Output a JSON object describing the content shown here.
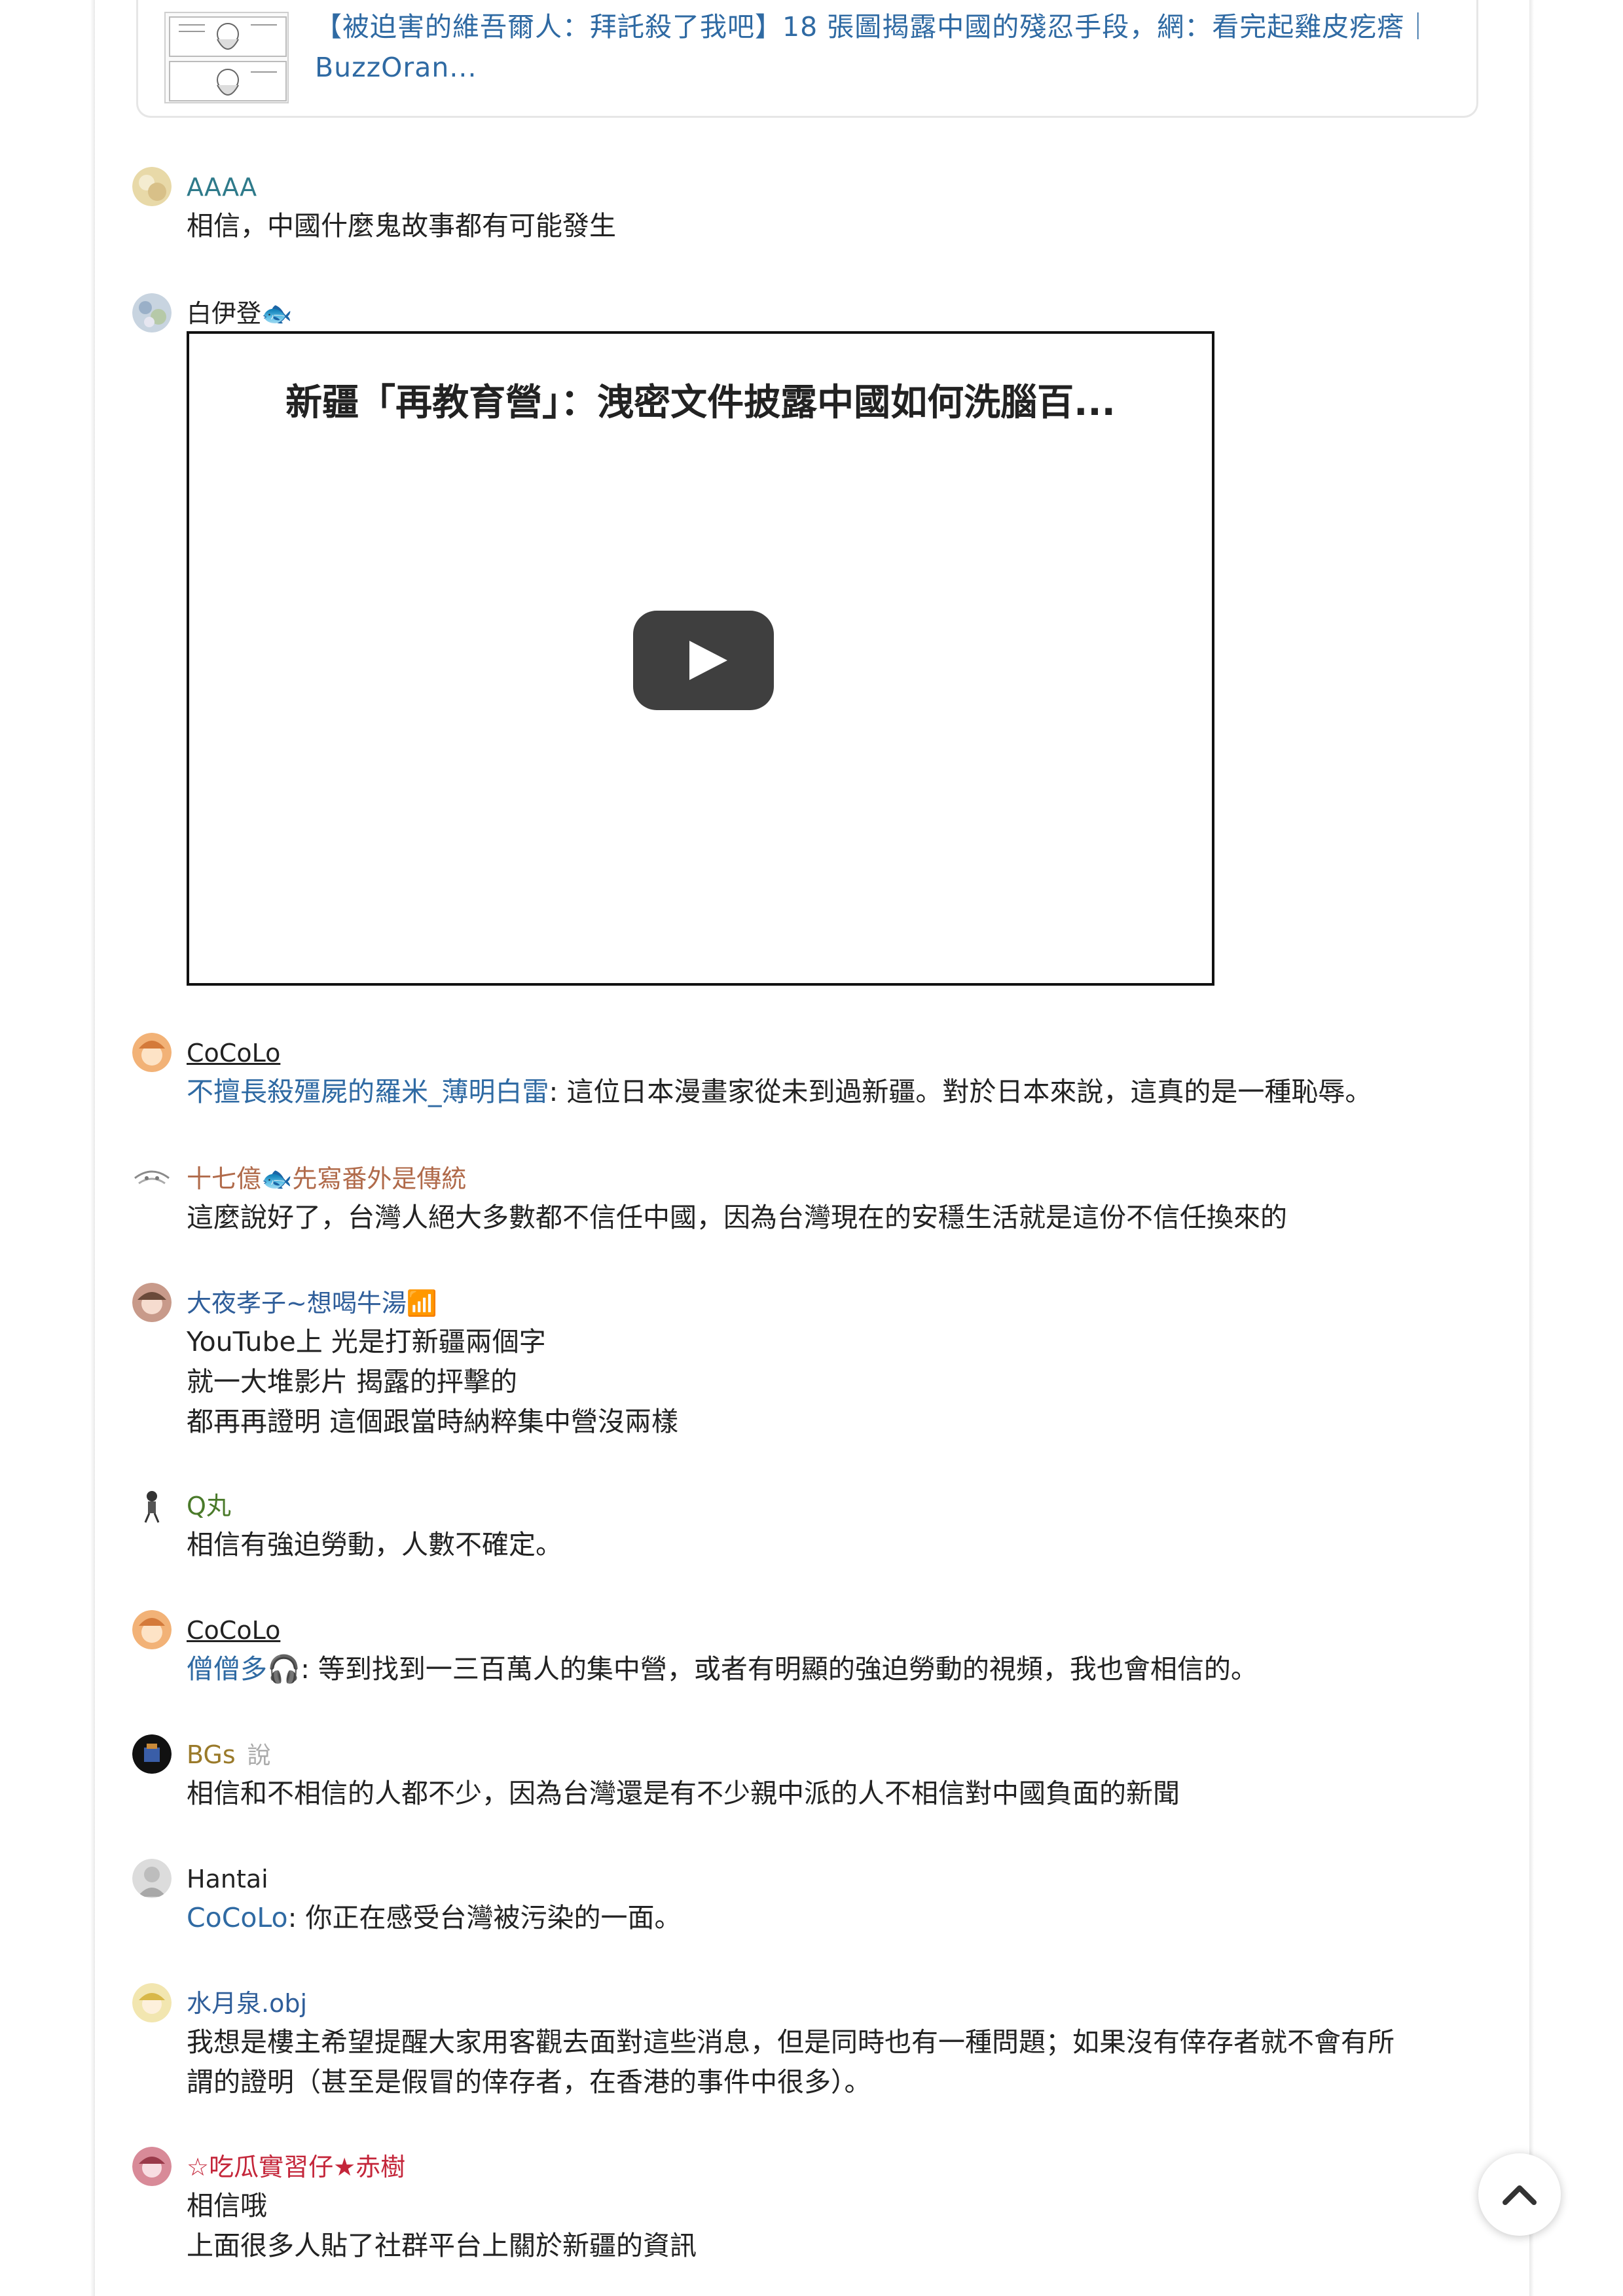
{
  "link_preview": {
    "title": "【被迫害的維吾爾人：拜託殺了我吧】18 張圖揭露中國的殘忍手段，網：看完起雞皮疙瘩｜BuzzOran...",
    "thumbnail_icon": "comic-thumbnail"
  },
  "colors": {
    "link": "#2f6aa3",
    "text": "#222222",
    "author_gold": "#9a7a2a",
    "author_brown": "#b06a4a",
    "author_blue": "#2f5e9a",
    "author_green": "#4a7a2a",
    "author_red": "#c4263a"
  },
  "posts": [
    {
      "author": "AAAA",
      "said": "",
      "lines": [
        "相信，中國什麼鬼故事都有可能發生"
      ]
    },
    {
      "author": "白伊登🐟",
      "said": "",
      "video": {
        "title": "新疆「再教育營」：洩密文件披露中國如何洗腦百...",
        "play_icon": "play-icon"
      }
    },
    {
      "author": "CoCoLo",
      "said": "",
      "reply_to": "不擅長殺殭屍的羅米_薄明白雷",
      "lines": [
        ": 這位日本漫畫家從未到過新疆。對於日本來說，這真的是一種恥辱。"
      ]
    },
    {
      "author": "十七億🐟先寫番外是傳統",
      "said": "",
      "lines": [
        "這麼說好了，台灣人絕大多數都不信任中國，因為台灣現在的安穩生活就是這份不信任換來的"
      ]
    },
    {
      "author": "大夜孝子~想喝牛湯📶",
      "said": "",
      "lines": [
        "YouTube上 光是打新疆兩個字",
        "就一大堆影片 揭露的抨擊的",
        "都再再證明 這個跟當時納粹集中營沒兩樣"
      ]
    },
    {
      "author": "Q丸",
      "said": "",
      "lines": [
        "相信有強迫勞動，人數不確定。"
      ]
    },
    {
      "author": "CoCoLo",
      "said": "",
      "reply_to": "僧僧多🎧",
      "lines": [
        ": 等到找到一三百萬人的集中營，或者有明顯的強迫勞動的視頻，我也會相信的。"
      ]
    },
    {
      "author": "BGs",
      "said": "說",
      "lines": [
        "相信和不相信的人都不少，因為台灣還是有不少親中派的人不相信對中國負面的新聞"
      ]
    },
    {
      "author": "Hantai",
      "said": "",
      "reply_to": "CoCoLo",
      "lines": [
        ": 你正在感受台灣被污染的一面。"
      ]
    },
    {
      "author": "水月泉.obj",
      "said": "",
      "lines": [
        "我想是樓主希望提醒大家用客觀去面對這些消息，但是同時也有一種問題；如果沒有倖存者就不會有所",
        "謂的證明（甚至是假冒的倖存者，在香港的事件中很多）。"
      ]
    },
    {
      "author": "☆吃瓜實習仔★赤樹",
      "said": "",
      "lines": [
        "相信哦",
        "上面很多人貼了社群平台上關於新疆的資訊"
      ]
    }
  ],
  "scroll_top_icon": "chevron-up-icon"
}
